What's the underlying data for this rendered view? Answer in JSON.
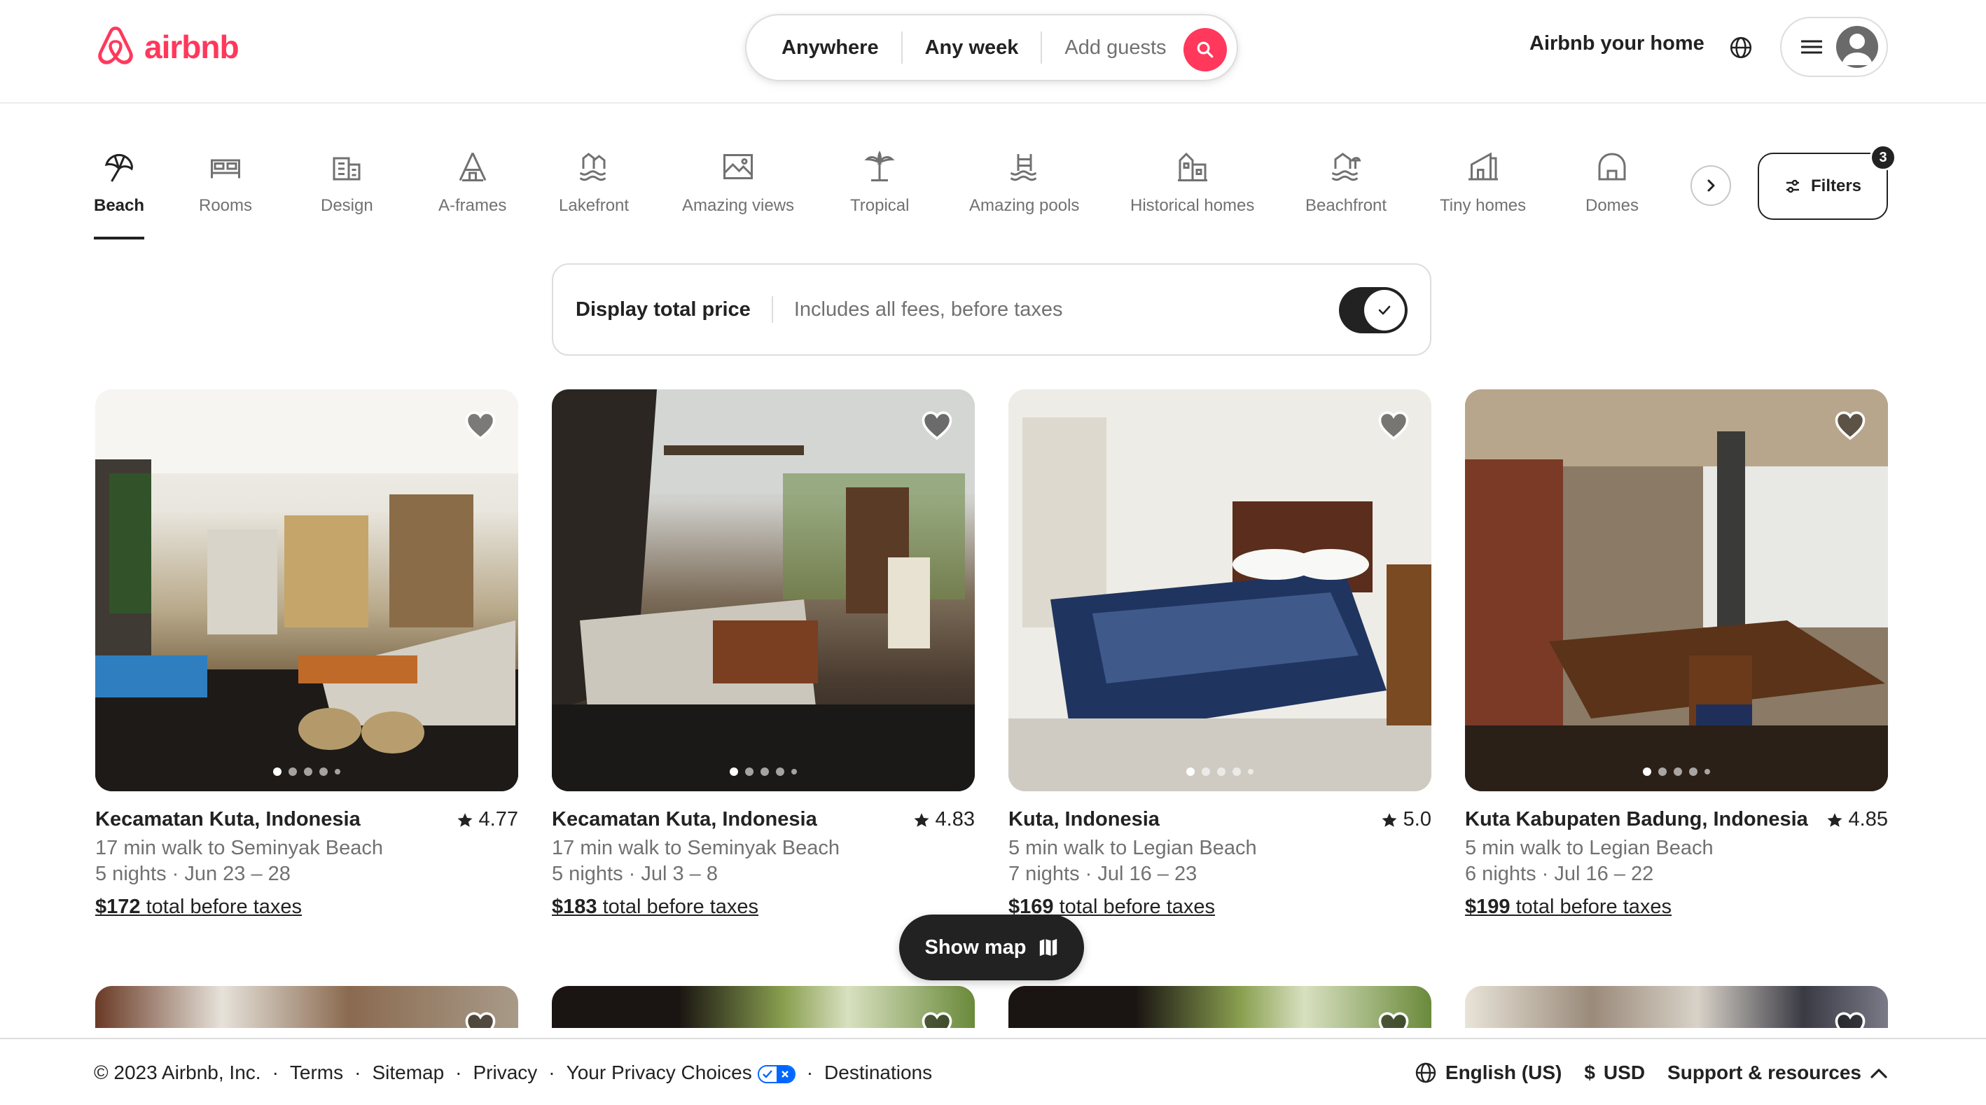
{
  "brand": {
    "name": "airbnb",
    "color": "#ff385c"
  },
  "search": {
    "location": "Anywhere",
    "dates": "Any week",
    "guests_placeholder": "Add guests"
  },
  "header": {
    "host_link": "Airbnb your home"
  },
  "categories": [
    {
      "label": "Beach",
      "icon": "beach-umbrella-icon",
      "active": true
    },
    {
      "label": "Rooms",
      "icon": "bed-icon"
    },
    {
      "label": "Design",
      "icon": "building-icon"
    },
    {
      "label": "A-frames",
      "icon": "a-frame-icon"
    },
    {
      "label": "Lakefront",
      "icon": "lakefront-icon"
    },
    {
      "label": "Amazing views",
      "icon": "picture-icon"
    },
    {
      "label": "Tropical",
      "icon": "palm-tree-icon"
    },
    {
      "label": "Amazing pools",
      "icon": "pool-icon"
    },
    {
      "label": "Historical homes",
      "icon": "historical-home-icon"
    },
    {
      "label": "Beachfront",
      "icon": "beachfront-icon"
    },
    {
      "label": "Tiny homes",
      "icon": "tiny-home-icon"
    },
    {
      "label": "Domes",
      "icon": "dome-icon"
    }
  ],
  "filters": {
    "label": "Filters",
    "count": "3"
  },
  "price_toggle": {
    "title": "Display total price",
    "subtitle": "Includes all fees, before taxes",
    "enabled": true
  },
  "listings": [
    {
      "title": "Kecamatan Kuta, Indonesia",
      "rating": "4.77",
      "distance": "17 min walk to Seminyak Beach",
      "stay": "5 nights · Jun 23 – 28",
      "price": "$172",
      "price_suffix": "total before taxes"
    },
    {
      "title": "Kecamatan Kuta, Indonesia",
      "rating": "4.83",
      "distance": "17 min walk to Seminyak Beach",
      "stay": "5 nights · Jul 3 – 8",
      "price": "$183",
      "price_suffix": "total before taxes"
    },
    {
      "title": "Kuta, Indonesia",
      "rating": "5.0",
      "distance": "5 min walk to Legian Beach",
      "stay": "7 nights · Jul 16 – 23",
      "price": "$169",
      "price_suffix": "total before taxes"
    },
    {
      "title": "Kuta Kabupaten Badung, Indonesia",
      "rating": "4.85",
      "distance": "5 min walk to Legian Beach",
      "stay": "6 nights · Jul 16 – 22",
      "price": "$199",
      "price_suffix": "total before taxes"
    }
  ],
  "show_map": {
    "label": "Show map"
  },
  "footer": {
    "copyright": "© 2023 Airbnb, Inc.",
    "links": [
      "Terms",
      "Sitemap",
      "Privacy",
      "Your Privacy Choices",
      "Destinations"
    ],
    "language": "English (US)",
    "currency_symbol": "$",
    "currency": "USD",
    "support": "Support & resources"
  }
}
